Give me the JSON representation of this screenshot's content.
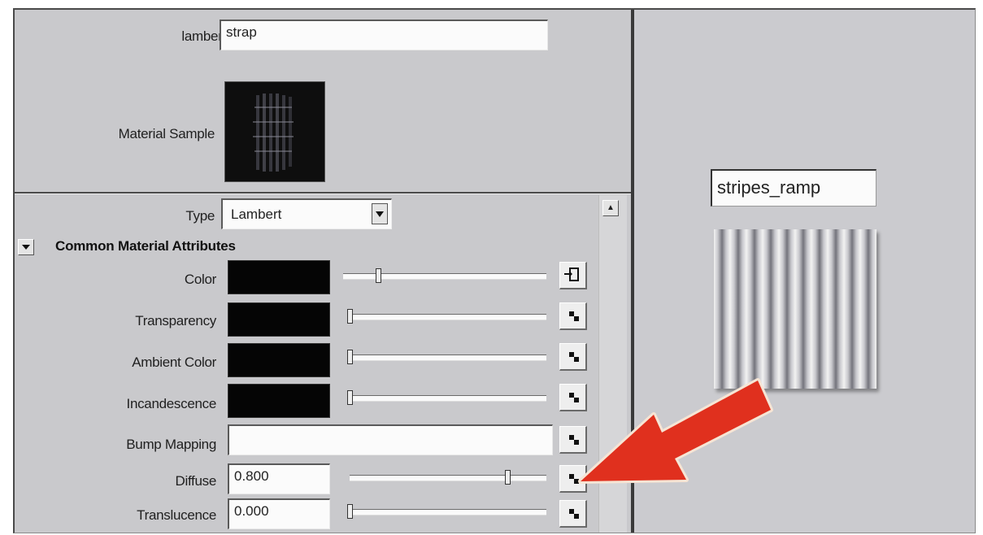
{
  "header": {
    "node_type_label": "lambert",
    "node_name": "strap",
    "sample_label": "Material Sample"
  },
  "type_row": {
    "label": "Type",
    "value": "Lambert"
  },
  "section": {
    "title": "Common Material Attributes"
  },
  "attributes": {
    "color": {
      "label": "Color"
    },
    "transparency": {
      "label": "Transparency"
    },
    "ambient": {
      "label": "Ambient Color"
    },
    "incandescence": {
      "label": "Incandescence"
    },
    "bump": {
      "label": "Bump Mapping"
    },
    "diffuse": {
      "label": "Diffuse",
      "value": "0.800"
    },
    "translucence": {
      "label": "Translucence",
      "value": "0.000"
    }
  },
  "slider_levels": {
    "color": 0.17,
    "transparency": 0.0,
    "ambient": 0.0,
    "incandescence": 0.0,
    "diffuse": 0.8,
    "translucence": 0.0
  },
  "texture": {
    "name": "stripes_ramp"
  },
  "colors": {
    "panel_bg": "#c9c9cc",
    "arrow": "#e0301e"
  },
  "icons": {
    "map_button": "checker-icon",
    "connected_map": "input-arrow-icon",
    "collapse": "triangle-down-icon",
    "dropdown": "triangle-down-icon"
  }
}
